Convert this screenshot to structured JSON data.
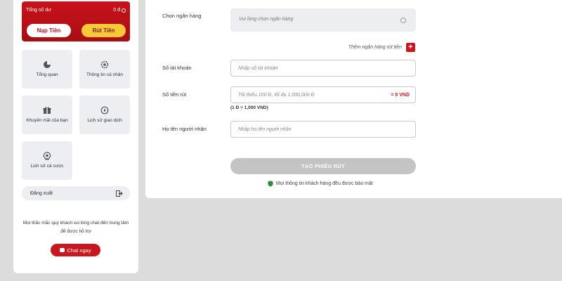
{
  "sidebar": {
    "balance": {
      "label": "Tổng số dư",
      "value": "0 đ"
    },
    "deposit_label": "Nạp Tiền",
    "withdraw_label": "Rút Tiền",
    "tiles": [
      {
        "label": "Tổng quan",
        "icon": "pie-chart-icon"
      },
      {
        "label": "Thông tin cá nhân",
        "icon": "user-gear-icon"
      },
      {
        "label": "Khuyến mãi của bạn",
        "icon": "gift-icon"
      },
      {
        "label": "Lịch sử giao dịch",
        "icon": "transaction-history-icon"
      },
      {
        "label": "Lịch sử cá cược",
        "icon": "bet-history-icon"
      }
    ],
    "logout_label": "Đăng xuất",
    "help_text": "Mọi thắc mắc quý khách vui lòng chat đến trung tâm để được hỗ trợ",
    "chat_label": "Chat ngay"
  },
  "form": {
    "bank_label": "Chọn ngân hàng",
    "bank_placeholder": "Vui lòng chọn ngân hàng",
    "add_bank_label": "Thêm ngân hàng rút tiền",
    "account_label": "Số tài khoản",
    "account_placeholder": "Nhập số tài khoản",
    "amount_label": "Số tiền rút",
    "amount_placeholder": "Tối thiểu 100 Đ, tối đa 1,000,000 Đ",
    "amount_suffix": "= 0 VND",
    "amount_note": "(1 Đ = 1,000 VND)",
    "name_label": "Họ tên người nhận",
    "name_placeholder": "Nhập họ tên người nhận",
    "submit_label": "TẠO PHIẾU RÚT",
    "secure_text": "Mọi thông tin khách hàng đều được bảo mật"
  },
  "colors": {
    "brand_red": "#c8171f",
    "accent_yellow": "#f6c93b",
    "disabled_gray": "#c4c4c4"
  }
}
